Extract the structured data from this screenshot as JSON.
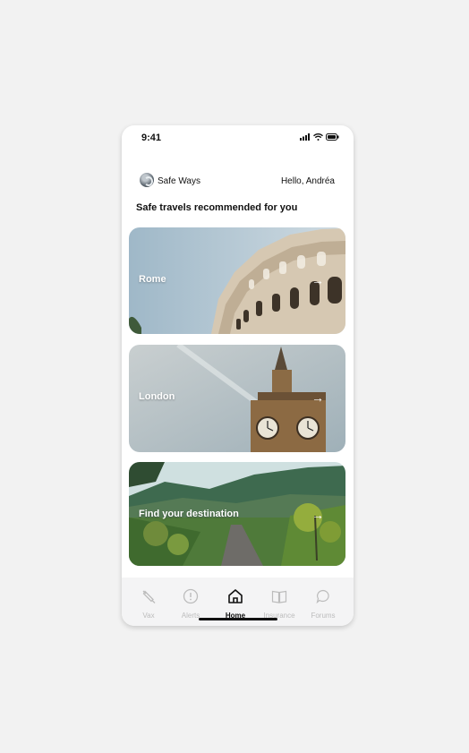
{
  "status": {
    "time": "9:41"
  },
  "header": {
    "brand": "Safe Ways",
    "greeting": "Hello, Andréa"
  },
  "section_title": "Safe travels recommended for you",
  "cards": [
    {
      "label": "Rome",
      "icon": "arrow-right-icon"
    },
    {
      "label": "London",
      "icon": "arrow-right-icon"
    },
    {
      "label": "Find your destination",
      "icon": "arrow-right-icon"
    }
  ],
  "tabs": [
    {
      "label": "Vax",
      "icon": "syringe-icon",
      "active": false
    },
    {
      "label": "Alerts",
      "icon": "alert-icon",
      "active": false
    },
    {
      "label": "Home",
      "icon": "home-icon",
      "active": true
    },
    {
      "label": "Insurance",
      "icon": "book-icon",
      "active": false
    },
    {
      "label": "Forums",
      "icon": "chat-bubble-icon",
      "active": false
    }
  ],
  "colors": {
    "background": "#f2f2f2",
    "active": "#111111",
    "inactive": "#bcbcbc"
  }
}
